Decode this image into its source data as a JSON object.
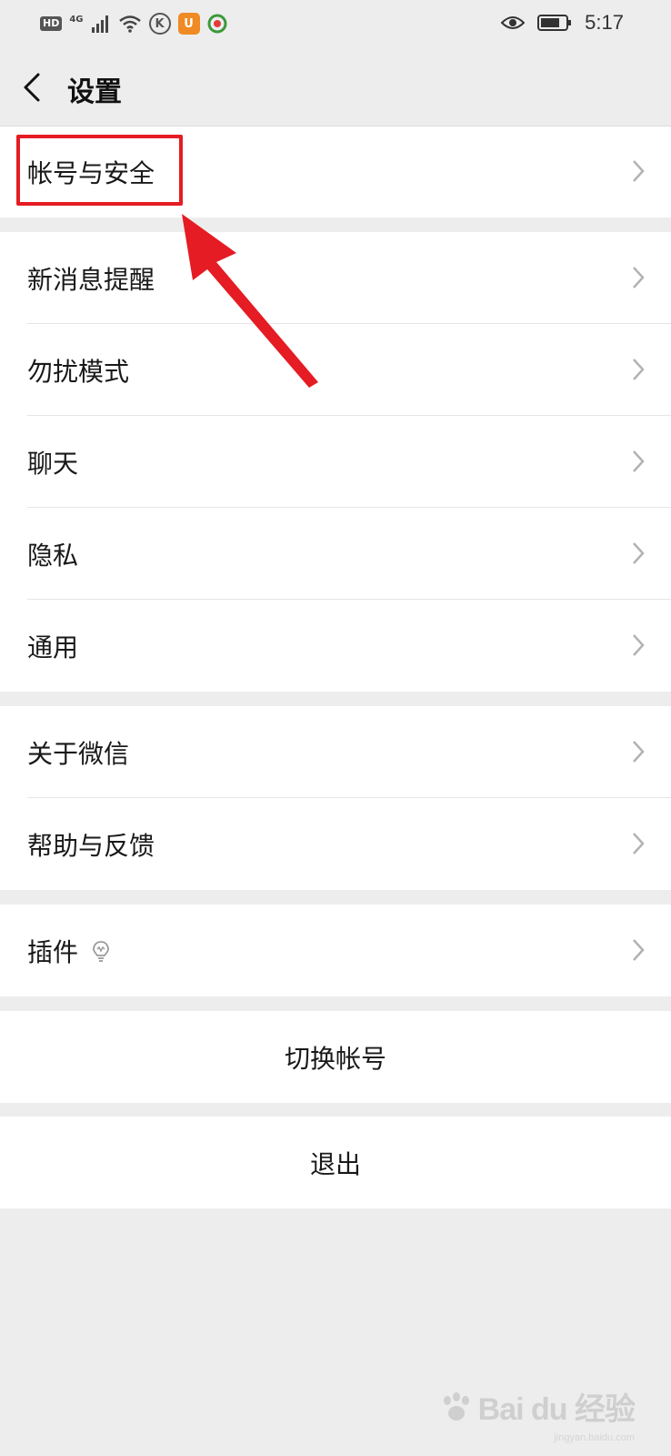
{
  "status_bar": {
    "hd_label": "HD",
    "network_label": "4G",
    "time": "5:17"
  },
  "header": {
    "title": "设置"
  },
  "groups": [
    {
      "items": [
        {
          "label": "帐号与安全"
        }
      ]
    },
    {
      "items": [
        {
          "label": "新消息提醒"
        },
        {
          "label": "勿扰模式"
        },
        {
          "label": "聊天"
        },
        {
          "label": "隐私"
        },
        {
          "label": "通用"
        }
      ]
    },
    {
      "items": [
        {
          "label": "关于微信"
        },
        {
          "label": "帮助与反馈"
        }
      ]
    },
    {
      "items": [
        {
          "label": "插件"
        }
      ]
    }
  ],
  "actions": {
    "switch_account": "切换帐号",
    "logout": "退出"
  },
  "watermark": {
    "brand": "Bai du 经验",
    "url": "jingyan.baidu.com"
  },
  "colors": {
    "accent_red": "#e51c23",
    "background": "#ededed"
  },
  "icons": [
    "back-arrow-icon",
    "chevron-right-icon",
    "lightbulb-icon",
    "eye-icon",
    "battery-icon",
    "wifi-icon",
    "signal-icon"
  ]
}
